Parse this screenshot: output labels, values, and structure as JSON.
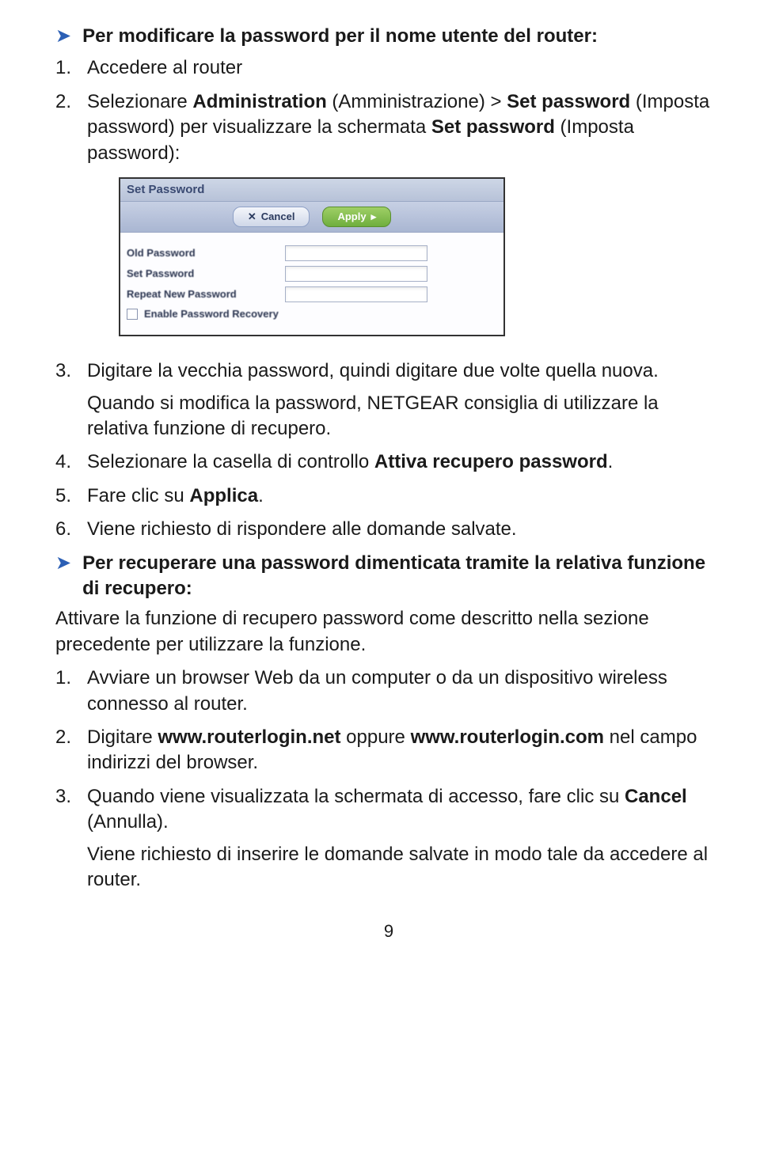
{
  "heading1": "Per modificare la password per il nome utente del router:",
  "list1": {
    "i1": {
      "num": "1.",
      "text": "Accedere al router"
    },
    "i2": {
      "num": "2.",
      "p1a": "Selezionare ",
      "p1b": "Administration",
      "p1c": " (Amministrazione) > ",
      "p1d": "Set password",
      "p1e": " (Imposta password) per visualizzare la schermata ",
      "p1f": "Set password",
      "p1g": " (Imposta password):"
    },
    "i3": {
      "num": "3.",
      "p1": "Digitare la vecchia password, quindi digitare due volte quella nuova.",
      "p2": "Quando si modifica la password, NETGEAR consiglia di utilizzare la relativa funzione di recupero."
    },
    "i4": {
      "num": "4.",
      "p1a": "Selezionare la casella di controllo ",
      "p1b": "Attiva recupero password",
      "p1c": "."
    },
    "i5": {
      "num": "5.",
      "p1a": "Fare clic su ",
      "p1b": "Applica",
      "p1c": "."
    },
    "i6": {
      "num": "6.",
      "p1": "Viene richiesto di rispondere alle domande salvate."
    }
  },
  "heading2": "Per recuperare una password dimenticata tramite la relativa funzione di recupero:",
  "intro2": "Attivare la funzione di recupero password come descritto nella sezione precedente per utilizzare la funzione.",
  "list2": {
    "i1": {
      "num": "1.",
      "p1": "Avviare un browser Web da un computer o da un dispositivo wireless connesso al router."
    },
    "i2": {
      "num": "2.",
      "p1a": "Digitare ",
      "p1b": "www.routerlogin.net",
      "p1c": " oppure ",
      "p1d": "www.routerlogin.com",
      "p1e": " nel campo indirizzi del browser."
    },
    "i3": {
      "num": "3.",
      "p1a": "Quando viene visualizzata la schermata di accesso, fare clic su ",
      "p1b": "Cancel",
      "p1c": " (Annulla).",
      "p2": "Viene richiesto di inserire le domande salvate in modo tale da accedere al router."
    }
  },
  "screenshot": {
    "title": "Set Password",
    "cancel": "Cancel",
    "apply": "Apply",
    "row1": "Old Password",
    "row2": "Set Password",
    "row3": "Repeat New Password",
    "row4": "Enable Password Recovery"
  },
  "pagenum": "9"
}
